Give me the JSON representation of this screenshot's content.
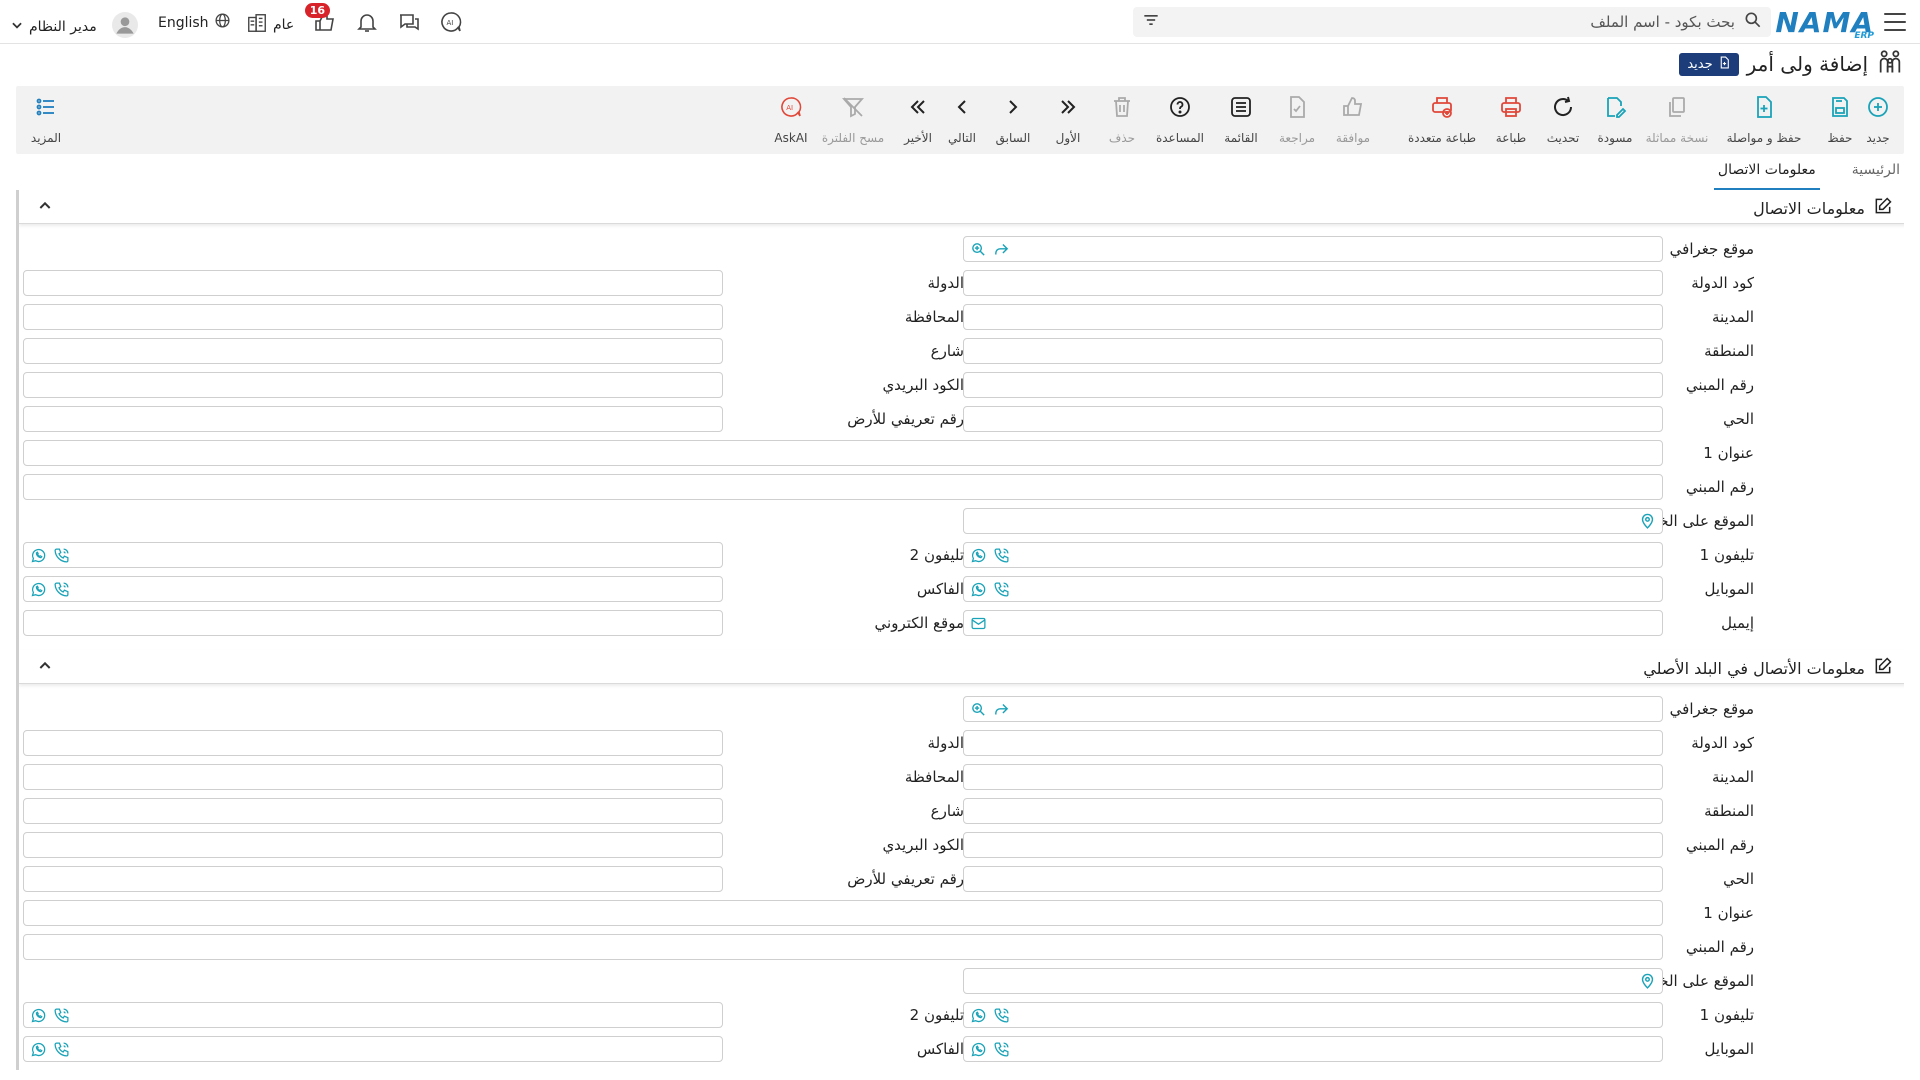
{
  "topbar": {
    "search_placeholder": "بحث بكود - اسم الملف",
    "logo_text": "NAMA",
    "logo_sub": "ERP",
    "notifications_count": "16",
    "company_label": "عام",
    "language_label": "English",
    "user_label": "مدير النظام"
  },
  "page": {
    "title": "إضافة ولى أمر",
    "status_badge": "جديد"
  },
  "toolbar": {
    "new": "جديد",
    "save": "حفظ",
    "save_continue": "حفظ و مواصلة",
    "duplicate": "نسخة مماثلة",
    "draft": "مسودة",
    "refresh": "تحديث",
    "print": "طباعة",
    "multi_print": "طباعة متعددة",
    "approve": "موافقة",
    "review": "مراجعة",
    "list": "القائمة",
    "help": "المساعدة",
    "delete": "حذف",
    "first": "الأول",
    "previous": "السابق",
    "next": "التالي",
    "last": "الأخير",
    "clear_filter": "مسح الفلترة",
    "askai": "AskAI",
    "more": "المزيد"
  },
  "tabs": {
    "main": "الرئيسية",
    "contact": "معلومات الاتصال"
  },
  "section1": {
    "title": "معلومات الاتصال",
    "geo": "موقع جغرافي",
    "country_code": "كود الدولة",
    "country": "الدولة",
    "city": "المدينة",
    "province": "المحافظة",
    "region": "المنطقة",
    "street": "شارع",
    "building_no": "رقم المبني",
    "postal_code": "الكود البريدي",
    "district": "الحي",
    "land_id": "رقم تعريفي للأرض",
    "address1": "عنوان 1",
    "building_no2": "رقم المبني",
    "map_location": "الموقع على الخريطة",
    "phone1": "تليفون 1",
    "phone2": "تليفون 2",
    "mobile": "الموبايل",
    "fax": "الفاكس",
    "email": "إيميل",
    "website": "موقع الكتروني"
  },
  "section2": {
    "title": "معلومات الأتصال في البلد الأصلي",
    "geo": "موقع جغرافي",
    "country_code": "كود الدولة",
    "country": "الدولة",
    "city": "المدينة",
    "province": "المحافظة",
    "region": "المنطقة",
    "street": "شارع",
    "building_no": "رقم المبني",
    "postal_code": "الكود البريدي",
    "district": "الحي",
    "land_id": "رقم تعريفي للأرض",
    "address1": "عنوان 1",
    "building_no2": "رقم المبني",
    "map_location": "الموقع على الخريطة",
    "phone1": "تليفون 1",
    "phone2": "تليفون 2",
    "mobile": "الموبايل",
    "fax": "الفاكس"
  },
  "colors": {
    "accent": "#1f7fbf",
    "icon_teal": "#1aa3b8",
    "print_red": "#e0483a",
    "badge_red": "#d8232a",
    "status_navy": "#1d3d7a"
  }
}
